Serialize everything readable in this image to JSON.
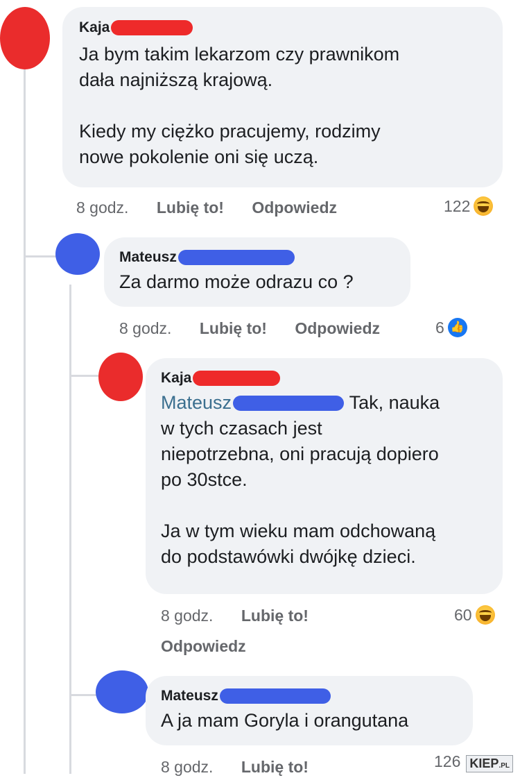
{
  "colors": {
    "avatar_red": "#ea2c2c",
    "avatar_blue": "#3f5fe6",
    "redact_red": "#ee2a2a",
    "redact_blue": "#3f5fe6",
    "bubble": "#f0f2f5",
    "meta": "#65676b"
  },
  "comments": [
    {
      "author": "Kaja",
      "text": "Ja bym takim lekarzom czy prawnikom\ndała najniższą krajową.\n\nKiedy my ciężko pracujemy, rodzimy\nnowe pokolenie oni się uczą.",
      "time": "8 godz.",
      "like": "Lubię to!",
      "reply": "Odpowiedz",
      "reaction_count": "122",
      "reaction_icon": "haha-emoji-icon"
    },
    {
      "author": "Mateusz",
      "text": "Za darmo może odrazu co ?",
      "time": "8 godz.",
      "like": "Lubię to!",
      "reply": "Odpowiedz",
      "reaction_count": "6",
      "reaction_icon": "like-icon"
    },
    {
      "author": "Kaja",
      "mention": "Mateusz",
      "text_after_mention": " Tak, nauka",
      "text": "w tych czasach jest\nniepotrzebna, oni pracują dopiero\npo 30stce.\n\nJa w tym wieku mam odchowaną\ndo podstawówki dwójkę dzieci.",
      "time": "8 godz.",
      "like": "Lubię to!",
      "reply": "Odpowiedz",
      "reaction_count": "60",
      "reaction_icon": "haha-emoji-icon"
    },
    {
      "author": "Mateusz",
      "text": "A ja mam Goryla i orangutana",
      "time": "8 godz.",
      "like": "Lubię to!",
      "reaction_count": "126"
    }
  ],
  "watermark": {
    "main": "KIEP",
    "suffix": ".PL"
  }
}
